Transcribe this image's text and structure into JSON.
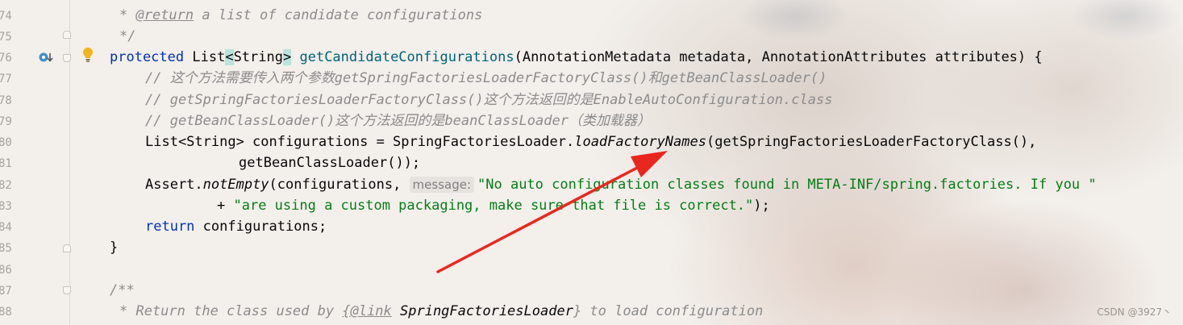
{
  "editor": {
    "line_numbers": [
      "74",
      "75",
      "76",
      "77",
      "78",
      "79",
      "80",
      "81",
      "82",
      "83",
      "84",
      "85",
      "86",
      "87",
      "88"
    ],
    "lines": {
      "l74_tag": "@return",
      "l74_rest": " a list of candidate configurations",
      "l75": "*/",
      "l76_kw": "protected",
      "l76_type1": " List",
      "l76_lt": "<",
      "l76_type2": "String",
      "l76_gt": ">",
      "l76_method": "getCandidateConfigurations",
      "l76_params": "(AnnotationMetadata metadata, AnnotationAttributes attributes) {",
      "l77": "// 这个方法需要传入两个参数getSpringFactoriesLoaderFactoryClass()和getBeanClassLoader()",
      "l78": "// getSpringFactoriesLoaderFactoryClass()这个方法返回的是EnableAutoConfiguration.class",
      "l79": "// getBeanClassLoader()这个方法返回的是beanClassLoader（类加载器）",
      "l80_a": "List<String> configurations = SpringFactoriesLoader.",
      "l80_b": "loadFactoryNames",
      "l80_c": "(getSpringFactoriesLoaderFactoryClass(),",
      "l81": "getBeanClassLoader());",
      "l82_a": "Assert.",
      "l82_b": "notEmpty",
      "l82_c": "(configurations, ",
      "l82_hint": "message:",
      "l82_str": "\"No auto configuration classes found in META-INF/spring.factories. If you \"",
      "l83_plus": "+ ",
      "l83_str": "\"are using a custom packaging, make sure that file is correct.\"",
      "l83_end": ");",
      "l84_kw": "return",
      "l84_rest": " configurations;",
      "l85": "}",
      "l87": "/**",
      "l88_a": "* Return the class used by ",
      "l88_tag": "{@link",
      "l88_b": " SpringFactoriesLoader",
      "l88_c": "}",
      "l88_d": " to load configuration"
    }
  },
  "watermark": "CSDN @3927丶",
  "colors": {
    "keyword": "#0033b3",
    "method": "#00627a",
    "comment": "#8c8c8c",
    "string": "#067d17",
    "arrow": "#e8281e"
  },
  "icons": [
    "override-method-icon",
    "lightbulb-icon",
    "fold-marker-icon"
  ]
}
